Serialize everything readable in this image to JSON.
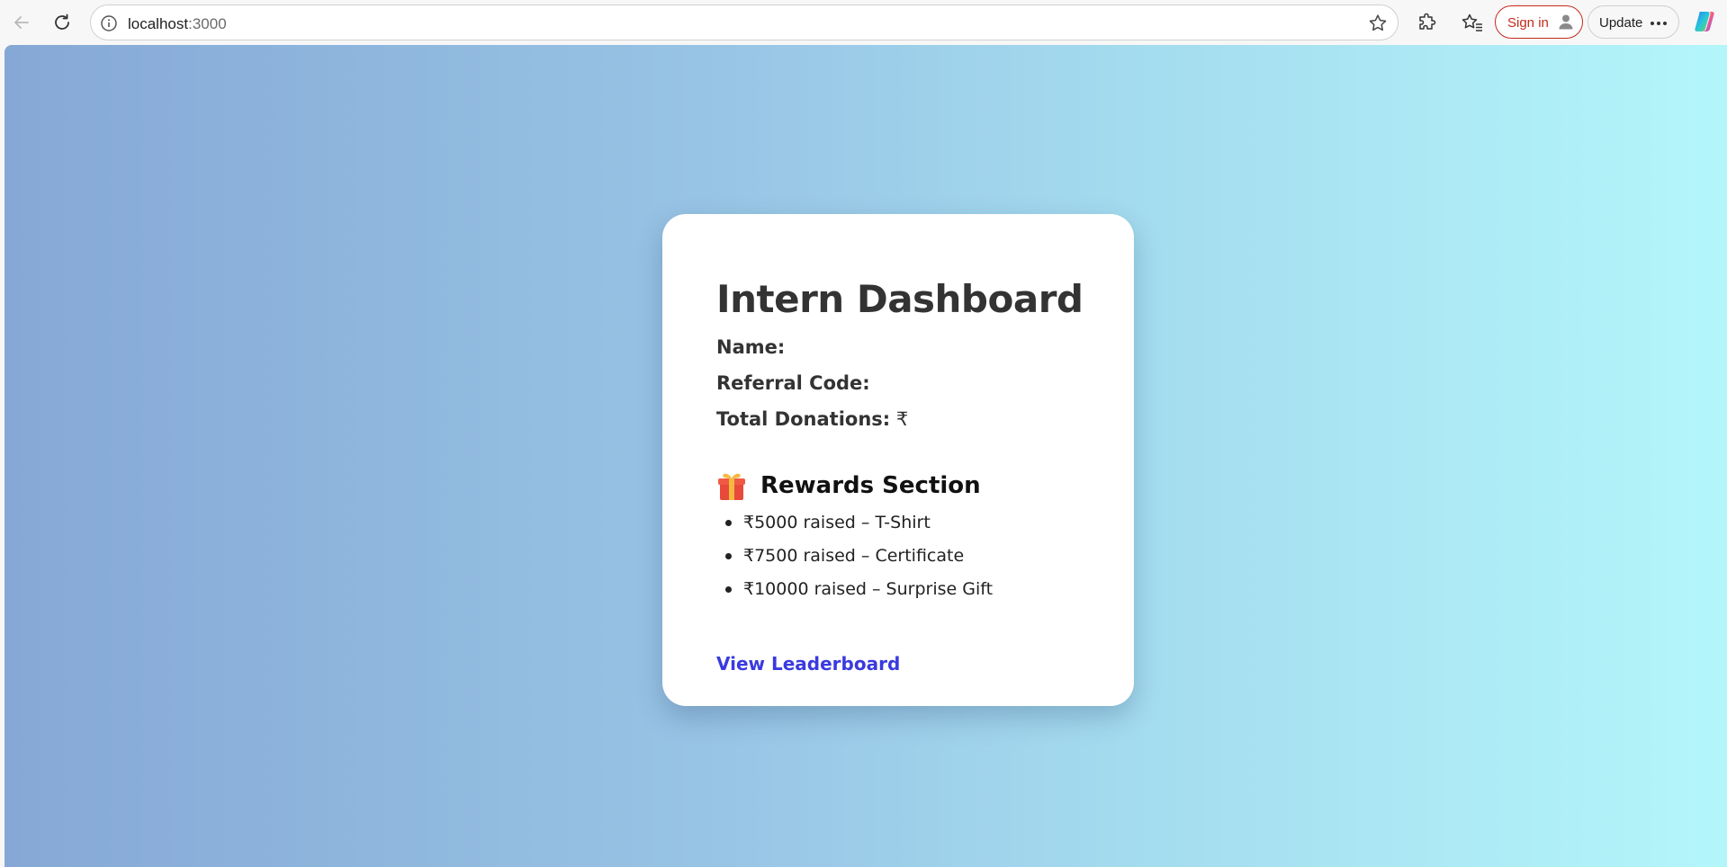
{
  "browser": {
    "url_host": "localhost",
    "url_port": ":3000",
    "sign_in_label": "Sign in",
    "update_label": "Update",
    "icons": {
      "back": "back-arrow-icon",
      "reload": "reload-icon",
      "site_info": "info-icon",
      "favorite": "star-icon",
      "extensions": "puzzle-icon",
      "favorites": "favorites-icon",
      "profile": "avatar-icon",
      "more": "more-icon",
      "copilot": "copilot-icon"
    },
    "accent_color": "#c42b1c"
  },
  "dashboard": {
    "title": "Intern Dashboard",
    "name_label": "Name:",
    "name_value": "",
    "referral_label": "Referral Code:",
    "referral_value": "",
    "donations_label": "Total Donations:",
    "donations_value": "₹",
    "rewards_icon": "gift-icon",
    "rewards_title": "Rewards Section",
    "rewards": [
      "₹5000 raised – T-Shirt",
      "₹7500 raised – Certificate",
      "₹10000 raised – Surprise Gift"
    ],
    "leaderboard_link": "View Leaderboard",
    "link_color": "#3a3ae0"
  }
}
